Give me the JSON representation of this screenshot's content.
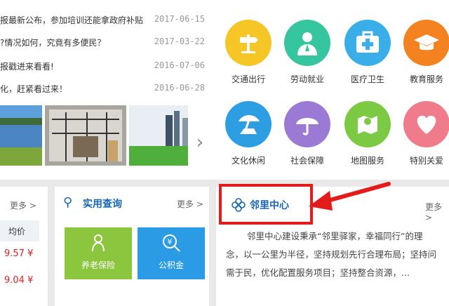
{
  "news": [
    {
      "title": "报最新公布，参加培训还能拿政府补贴",
      "date": "2017-06-15"
    },
    {
      "title": "?情况如何，究竟有多便民？",
      "date": "2017-03-22"
    },
    {
      "title": "报戳进来看看!",
      "date": "2016-07-06"
    },
    {
      "title": "化，赶紧看过来！",
      "date": "2016-06-28"
    }
  ],
  "services_row1": [
    {
      "label": "交通出行",
      "icon": "signpost-icon",
      "color": "#f6c526"
    },
    {
      "label": "劳动就业",
      "icon": "worker-icon",
      "color": "#35c6a0"
    },
    {
      "label": "医疗卫生",
      "icon": "medical-kit-icon",
      "color": "#3aaee8"
    },
    {
      "label": "教育服务",
      "icon": "graduation-cap-icon",
      "color": "#f58220"
    }
  ],
  "services_row2": [
    {
      "label": "文化休闲",
      "icon": "beach-umbrella-icon",
      "color": "#2e9ee3"
    },
    {
      "label": "社会保障",
      "icon": "umbrella-icon",
      "color": "#9b7ad6"
    },
    {
      "label": "地图服务",
      "icon": "map-icon",
      "color": "#7cc943"
    },
    {
      "label": "特别关爱",
      "icon": "heart-icon",
      "color": "#f07b8a"
    }
  ],
  "price_panel": {
    "more": "更多 >",
    "col_header": "均价",
    "prices": [
      "9.57 ¥",
      "9.04 ¥"
    ]
  },
  "query_panel": {
    "title": "实用查询",
    "more": "更多 >",
    "tiles": [
      {
        "label": "养老保险",
        "icon": "elder-icon",
        "color": "#8cc63f"
      },
      {
        "label": "公积金",
        "icon": "yuan-search-icon",
        "color": "#2c9be6"
      }
    ]
  },
  "neighbor_panel": {
    "title": "邻里中心",
    "more": "更多 >",
    "text": [
      "邻里中心建设秉承“邻里驿家，幸福同行”的理",
      "念，以一公里为半径，坚持规划先行合理布局；坚持问",
      "需于民，优化配置服务项目；坚持整合资源，..."
    ]
  },
  "colors": {
    "accent": "#1a68b4",
    "annotation": "#e31b1b"
  }
}
